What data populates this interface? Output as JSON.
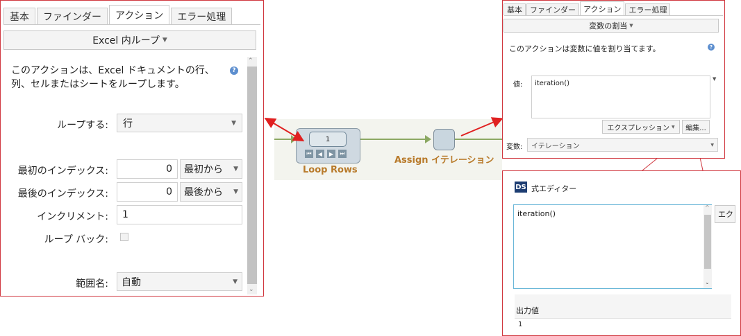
{
  "left_panel": {
    "tabs": [
      "基本",
      "ファインダー",
      "アクション",
      "エラー処理"
    ],
    "active_tab": "アクション",
    "action_selector": "Excel 内ループ",
    "description": "このアクションは、Excel ドキュメントの行、列、セルまたはシートをループします。",
    "help": "?",
    "fields": {
      "loop_label": "ループする:",
      "loop_value": "行",
      "first_index_label": "最初のインデックス:",
      "first_index_value": "0",
      "first_index_mode": "最初から",
      "last_index_label": "最後のインデックス:",
      "last_index_value": "0",
      "last_index_mode": "最後から",
      "increment_label": "インクリメント:",
      "increment_value": "1",
      "loop_back_label": "ループ バック:",
      "range_name_label": "範囲名:",
      "range_name_value": "自動"
    }
  },
  "flow": {
    "loop_activity_label": "Loop Rows",
    "loop_counter": "1",
    "assign_label": "Assign イテレーション"
  },
  "top_right_panel": {
    "tabs": [
      "基本",
      "ファインダー",
      "アクション",
      "エラー処理"
    ],
    "active_tab": "アクション",
    "action_selector": "変数の割当",
    "description": "このアクションは変数に値を割り当てます。",
    "help": "?",
    "value_label": "値:",
    "value_text": "iteration()",
    "expression_button": "エクスプレッション",
    "edit_button": "編集...",
    "variable_label": "変数:",
    "variable_value": "イテレーション"
  },
  "expression_editor": {
    "logo": "DS",
    "title": "式エディター",
    "expression": "iteration()",
    "side_button": "エク",
    "output_label": "出力値",
    "output_value": "1"
  },
  "colors": {
    "highlight_border": "#d0373f",
    "arrow": "#e02020",
    "flow_line": "#8ba862",
    "flow_label": "#b87a2a"
  }
}
